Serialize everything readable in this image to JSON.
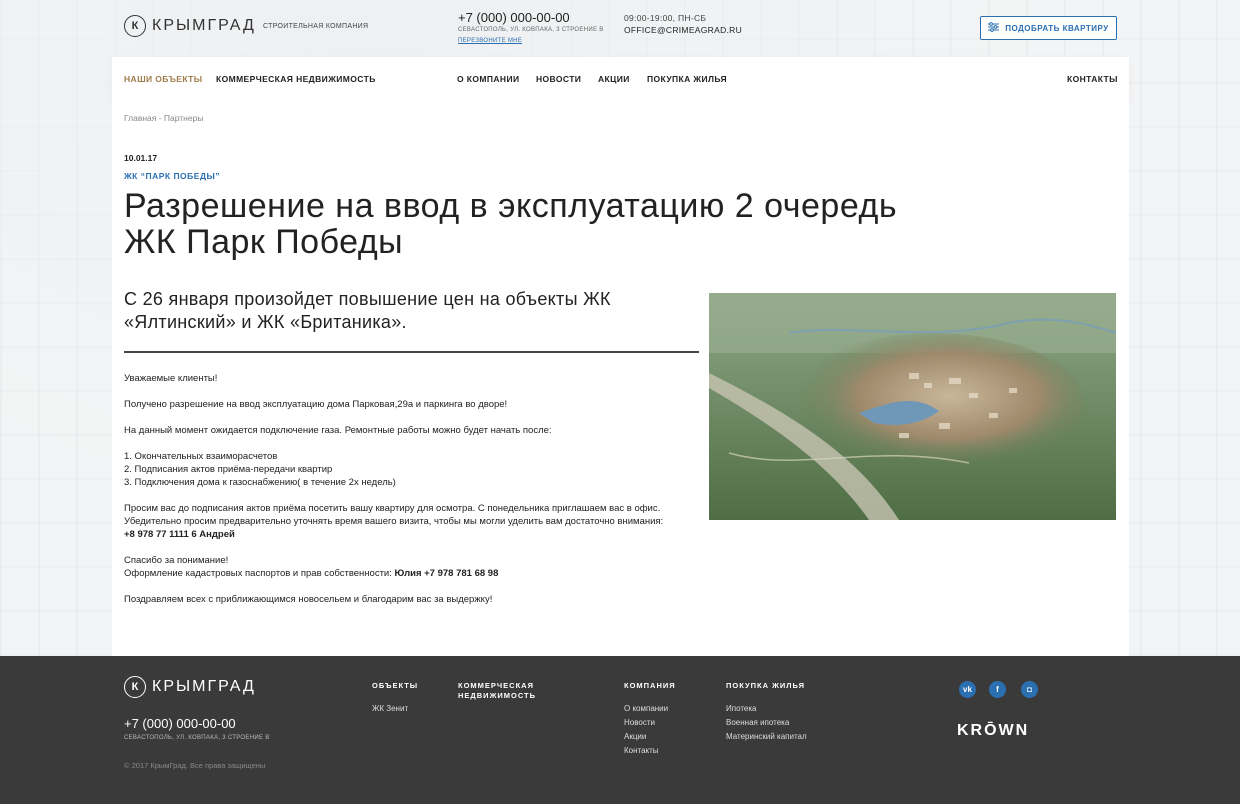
{
  "header": {
    "logo_text": "КРЫМГРАД",
    "logo_mark": "К",
    "tagline": "Строительная компания",
    "phone": "+7 (000) 000-00-00",
    "address": "Севастополь, ул. Ковпака, 3 строение В",
    "callback": "Перезвоните мне",
    "hours": "09:00-19:00, ПН-СБ",
    "email": "office@crimeagrad.ru",
    "pick_button": "Подобрать квартиру",
    "pick_icon": "sliders-icon"
  },
  "nav": {
    "items": [
      {
        "label": "Наши объекты",
        "active": true
      },
      {
        "label": "Коммерческая недвижимость"
      },
      {
        "label": "О компании"
      },
      {
        "label": "Новости"
      },
      {
        "label": "Акции"
      },
      {
        "label": "Покупка жилья"
      },
      {
        "label": "Контакты"
      }
    ]
  },
  "breadcrumb": "Главная - Партнеры",
  "article": {
    "date": "10.01.17",
    "category": "ЖК “Парк Победы”",
    "title": "Разрешение на ввод в эксплуатацию 2 очередь ЖК Парк Победы",
    "lead": "С 26 января произойдет повышение цен на объекты ЖК «Ялтинский» и ЖК «Британика».",
    "p1": "Уважаемые клиенты!",
    "p2": "Получено разрешение на ввод эксплуатацию дома Парковая,29а и паркинга во дворе!",
    "p3": "На данный момент ожидается подключение газа. Ремонтные работы можно будет начать после:",
    "list1": "1. Окончательных взаиморасчетов",
    "list2": "2. Подписания актов приёма-передачи квартир",
    "list3": "3. Подключения дома к газоснабжению( в течение 2х недель)",
    "p4a": "Просим вас до подписания актов приёма посетить вашу квартиру для осмотра. С понедельника приглашаем вас в офис.",
    "p4b": "Убедительно просим  предварительно уточнять время вашего визита, чтобы мы могли уделить вам достаточно внимания:",
    "p4c": "+8 978 77 1111 6 Андрей",
    "p5a": "Спасибо за понимание!",
    "p5b": "Оформление кадастровых паспортов и прав собственности:",
    "p5c": "Юлия  +7 978 781 68 98",
    "p6": "Поздравляем всех с приближающимся новосельем и благодарим вас за выдержку!"
  },
  "footer": {
    "logo_text": "КРЫМГРАД",
    "logo_mark": "К",
    "phone": "+7 (000) 000-00-00",
    "address": "Севастополь, ул. Ковпака, 3 строение В",
    "copyright": "© 2017 КрымГрад. Все права защищены",
    "col_objects": {
      "title": "Объекты",
      "links": [
        "ЖК Зенит"
      ]
    },
    "col_commercial": {
      "title": "Коммерческая недвижимость"
    },
    "col_company": {
      "title": "Компания",
      "links": [
        "О компании",
        "Новости",
        "Акции",
        "Контакты"
      ]
    },
    "col_purchase": {
      "title": "Покупка жилья",
      "links": [
        "Ипотека",
        "Военная ипотека",
        "Материнский капитал"
      ]
    },
    "social": [
      {
        "icon": "vk-icon",
        "glyph": "vk"
      },
      {
        "icon": "facebook-icon",
        "glyph": "f"
      },
      {
        "icon": "instagram-icon",
        "glyph": "◘"
      }
    ],
    "partner_logo": "KRŌWN"
  },
  "colors": {
    "accent": "#2a6fb0",
    "nav_active": "#a07c4a",
    "footer_bg": "#3a3a3a"
  }
}
